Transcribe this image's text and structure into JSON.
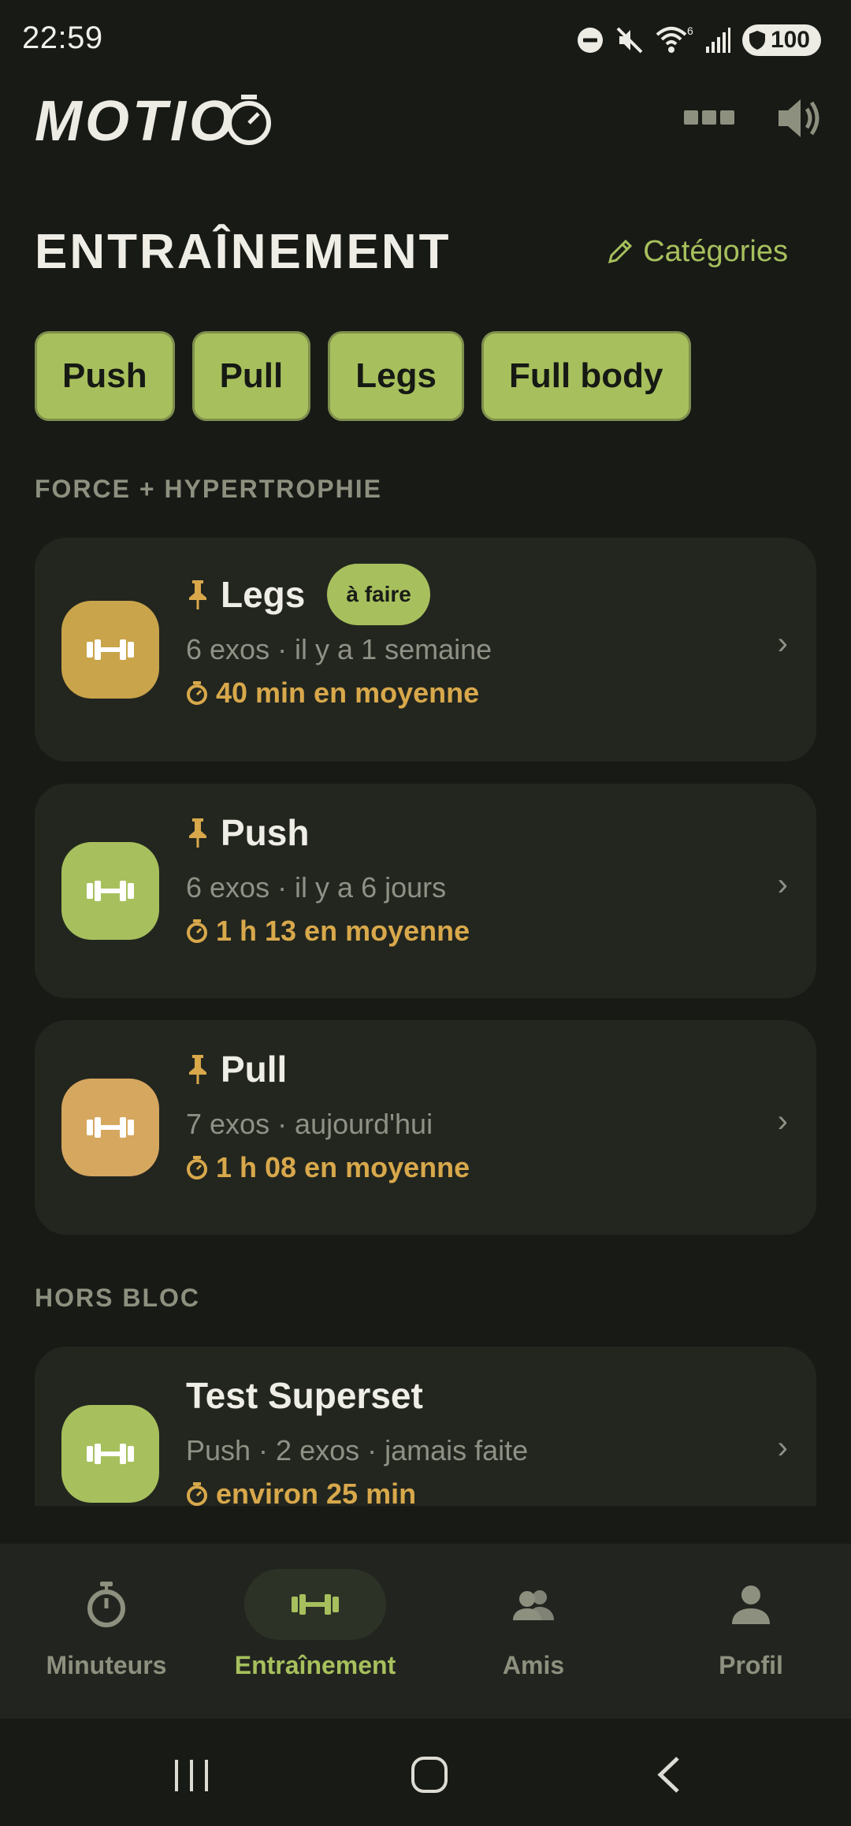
{
  "status": {
    "time": "22:59",
    "wifi_superscript": "6",
    "battery": "100"
  },
  "header": {
    "logo": "MOTIO"
  },
  "page": {
    "title": "ENTRAÎNEMENT",
    "categories_link": "Catégories"
  },
  "chips": [
    "Push",
    "Pull",
    "Legs",
    "Full body"
  ],
  "sections": {
    "force": "FORCE + HYPERTROPHIE",
    "hors_bloc": "HORS BLOC"
  },
  "workouts": [
    {
      "title": "Legs",
      "badge": "à faire",
      "sub": "6 exos · il y a 1 semaine",
      "avg": "40 min en moyenne",
      "icon_color": "#c9a44a",
      "pinned": true
    },
    {
      "title": "Push",
      "sub": "6 exos · il y a 6 jours",
      "avg": "1 h 13 en moyenne",
      "icon_color": "#a7c05d",
      "pinned": true
    },
    {
      "title": "Pull",
      "sub": "7 exos · aujourd'hui",
      "avg": "1 h 08 en moyenne",
      "icon_color": "#d6a75f",
      "pinned": true
    },
    {
      "title": "Test Superset",
      "sub": "Push · 2 exos · jamais faite",
      "avg": "environ 25 min",
      "icon_color": "#a7c05d",
      "pinned": false
    }
  ],
  "nav": {
    "timers": "Minuteurs",
    "training": "Entraînement",
    "friends": "Amis",
    "profile": "Profil"
  },
  "colors": {
    "accent": "#a7c05d",
    "gold": "#d8a84b",
    "background": "#181a16",
    "card": "#23261f"
  }
}
